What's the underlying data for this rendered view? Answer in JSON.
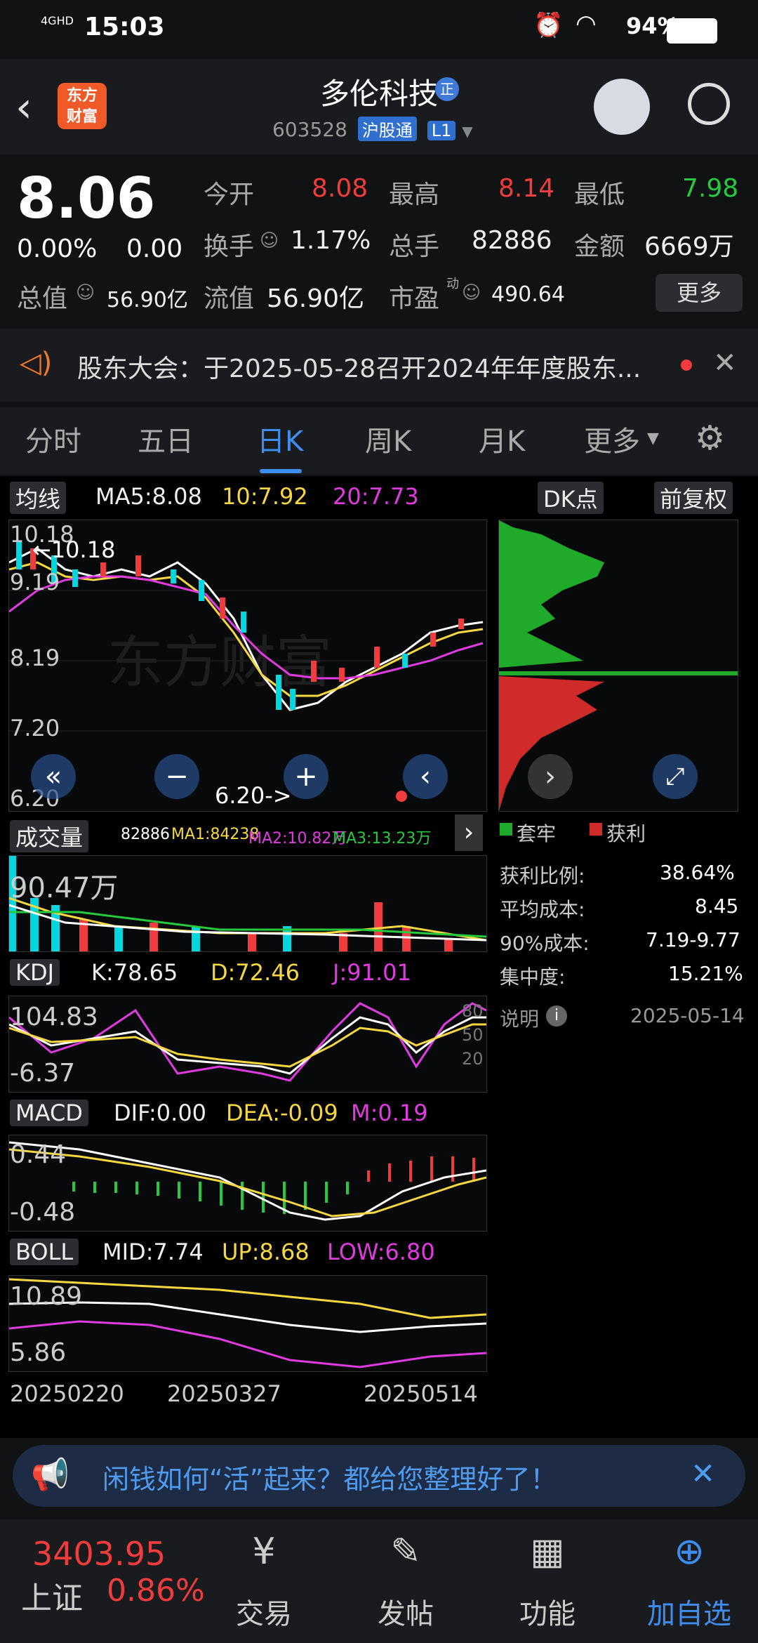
{
  "status": {
    "time": "15:03",
    "network": "4GHD",
    "battery": "94%"
  },
  "header": {
    "title": "多伦科技",
    "badge": "正",
    "code": "603528",
    "market_tag": "沪股通",
    "level_tag": "L1",
    "logo_line1": "东方",
    "logo_line2": "财富"
  },
  "quote": {
    "price": "8.06",
    "change_pct": "0.00%",
    "change": "0.00",
    "open_label": "今开",
    "open": "8.08",
    "high_label": "最高",
    "high": "8.14",
    "low_label": "最低",
    "low": "7.98",
    "turnover_label": "换手",
    "turnover": "1.17%",
    "volume_label": "总手",
    "volume": "82886",
    "amount_label": "金额",
    "amount": "6669万",
    "mktcap_label": "总值",
    "mktcap": "56.90亿",
    "float_label": "流值",
    "float": "56.90亿",
    "pe_label": "市盈",
    "pe_sup": "动",
    "pe": "490.64",
    "more": "更多"
  },
  "notice": {
    "text": "股东大会：于2025-05-28召开2024年年度股东..."
  },
  "tabs": [
    "分时",
    "五日",
    "日K",
    "周K",
    "月K",
    "更多"
  ],
  "kline": {
    "ma_label": "均线",
    "ma5": "MA5:8.08",
    "ma10": "10:7.92",
    "ma20": "20:7.73",
    "dk_button": "DK点",
    "adjust_button": "前复权",
    "y_labels": [
      "10.18",
      "9.19",
      "8.19",
      "7.20",
      "6.20"
    ],
    "hi_annot": "←10.18",
    "lo_annot": "6.20->"
  },
  "volume": {
    "label": "成交量",
    "vol": "82886",
    "ma1": "MA1:84238",
    "ma2": "MA2:10.82万",
    "ma3": "MA3:13.23万",
    "y": "90.47万"
  },
  "kdj": {
    "label": "KDJ",
    "k": "K:78.65",
    "d": "D:72.46",
    "j": "J:91.01",
    "y_top": "104.83",
    "y_bot": "-6.37",
    "levels": [
      "80",
      "50",
      "20"
    ]
  },
  "macd": {
    "label": "MACD",
    "dif": "DIF:0.00",
    "dea": "DEA:-0.09",
    "m": "M:0.19",
    "y_top": "0.44",
    "y_bot": "-0.48"
  },
  "boll": {
    "label": "BOLL",
    "mid": "MID:7.74",
    "up": "UP:8.68",
    "low": "LOW:6.80",
    "y_top": "10.89",
    "y_bot": "5.86"
  },
  "dates": [
    "20250220",
    "20250327",
    "20250514"
  ],
  "chip": {
    "legend_trap": "套牢",
    "legend_profit": "获利",
    "rows": [
      {
        "label": "获利比例:",
        "value": "38.64%"
      },
      {
        "label": "平均成本:",
        "value": "8.45"
      },
      {
        "label": "90%成本:",
        "value": "7.19-9.77"
      },
      {
        "label": "集中度:",
        "value": "15.21%"
      }
    ],
    "explain": "说明",
    "date": "2025-05-14"
  },
  "banner": {
    "text": "闲钱如何“活”起来？都给您整理好了！"
  },
  "bottom": {
    "index_value": "3403.95",
    "index_name": "上证",
    "index_pct": "0.86%",
    "items": [
      "交易",
      "发帖",
      "功能",
      "加自选"
    ]
  },
  "colors": {
    "up": "#f03c3c",
    "down": "#27c93f",
    "accent": "#3d8ef0",
    "ma10": "#f5d742",
    "ma20": "#e03ae0"
  }
}
